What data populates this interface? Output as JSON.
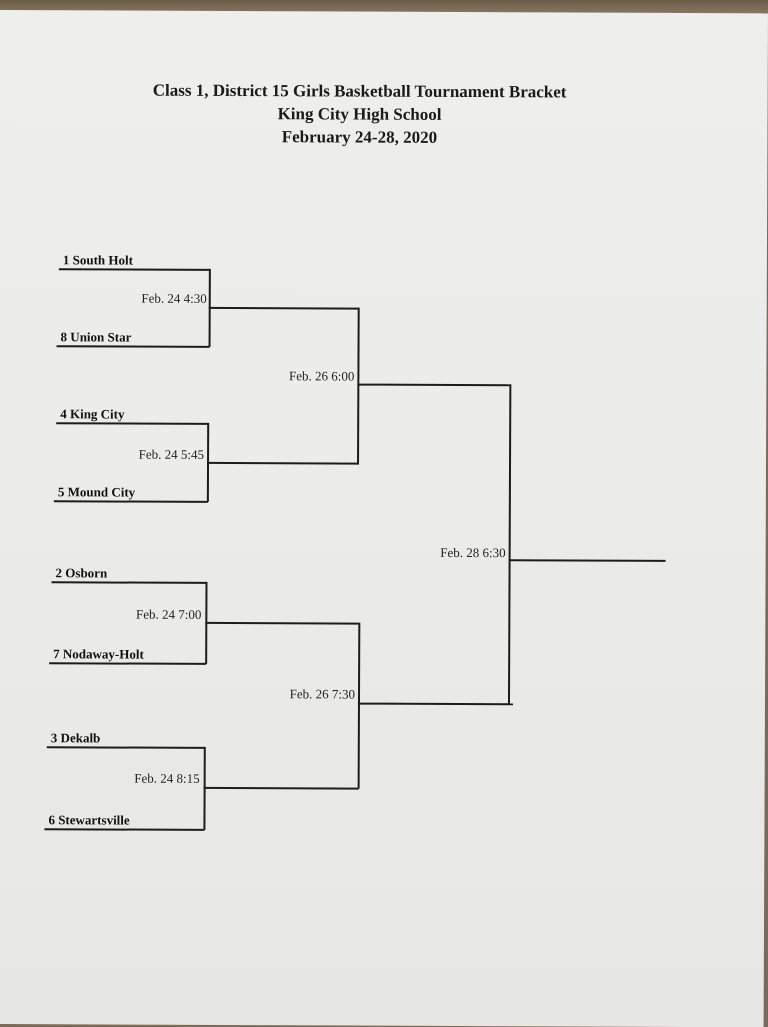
{
  "header": {
    "title": "Class 1, District 15 Girls Basketball Tournament Bracket",
    "school": "King City High School",
    "dates": "February 24-28, 2020"
  },
  "round1": {
    "teams": [
      "1 South Holt",
      "8 Union Star",
      "4 King City",
      "5 Mound City",
      "2 Osborn",
      "7 Nodaway-Holt",
      "3 Dekalb",
      "6 Stewartsville"
    ],
    "games": [
      "Feb. 24  4:30",
      "Feb. 24  5:45",
      "Feb. 24  7:00",
      "Feb. 24 8:15"
    ]
  },
  "semifinals": {
    "games": [
      "Feb. 26  6:00",
      "Feb. 26  7:30"
    ]
  },
  "final": {
    "game": "Feb. 28 6:30"
  }
}
